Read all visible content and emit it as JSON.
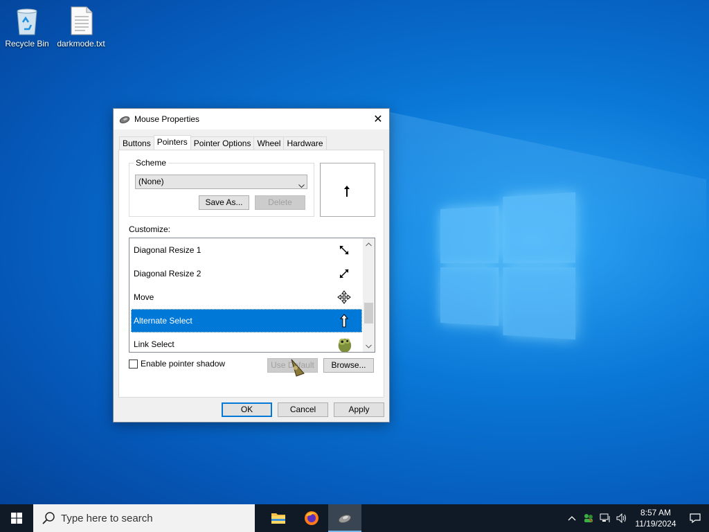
{
  "desktop": {
    "icons": [
      {
        "label": "Recycle Bin",
        "icon": "recycle-bin-icon"
      },
      {
        "label": "darkmode.txt",
        "icon": "text-file-icon"
      }
    ]
  },
  "dialog": {
    "title": "Mouse Properties",
    "close_label": "✕",
    "tabs": [
      "Buttons",
      "Pointers",
      "Pointer Options",
      "Wheel",
      "Hardware"
    ],
    "active_tab": "Pointers",
    "scheme": {
      "legend": "Scheme",
      "selected": "(None)",
      "save_as": "Save As...",
      "delete": "Delete"
    },
    "customize_label": "Customize:",
    "pointers": [
      {
        "name": "Diagonal Resize 1",
        "icon": "diagonal-resize-1-icon"
      },
      {
        "name": "Diagonal Resize 2",
        "icon": "diagonal-resize-2-icon"
      },
      {
        "name": "Move",
        "icon": "move-icon"
      },
      {
        "name": "Alternate Select",
        "icon": "alternate-select-icon",
        "selected": true
      },
      {
        "name": "Link Select",
        "icon": "link-select-icon"
      }
    ],
    "shadow_label": "Enable pointer shadow",
    "use_default": "Use Default",
    "browse": "Browse...",
    "ok": "OK",
    "cancel": "Cancel",
    "apply": "Apply"
  },
  "taskbar": {
    "search_placeholder": "Type here to search",
    "apps": [
      "file-explorer-icon",
      "firefox-icon",
      "mouse-properties-icon"
    ],
    "time": "8:57 AM",
    "date": "11/19/2024"
  }
}
